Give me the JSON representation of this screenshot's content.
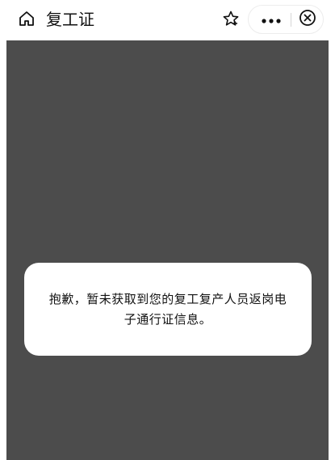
{
  "header": {
    "title": "复工证",
    "icons": {
      "home": "home-icon",
      "star": "star-icon",
      "more": "more-dots-icon",
      "close": "close-circle-icon"
    }
  },
  "dialog": {
    "message": "抱歉，暂未获取到您的复工复产人员返岗电子通行证信息。"
  },
  "colors": {
    "topbar_bg": "#ffffff",
    "content_bg": "#4c4c4c",
    "dialog_bg": "#ffffff",
    "text": "#111111"
  }
}
